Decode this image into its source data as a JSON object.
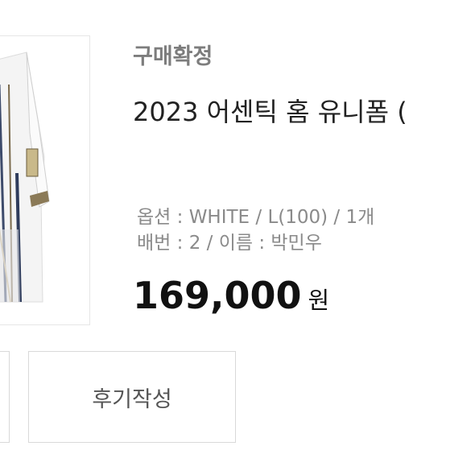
{
  "order": {
    "status": "구매확정",
    "product_name": "2023 어센틱 홈 유니폼 ( ",
    "option_line": "옵션 : WHITE / L(100) / 1개",
    "number_name_line": "배번 : 2 / 이름 : 박민우",
    "price": "169,000",
    "price_unit": "원"
  },
  "actions": {
    "review_label": "후기작성"
  },
  "icons": {
    "thumbnail": "baseball-jersey-image"
  },
  "colors": {
    "status_text": "#7d7d7d",
    "option_text": "#8a8a8a",
    "price_text": "#111111",
    "border": "#d9d9d9"
  }
}
